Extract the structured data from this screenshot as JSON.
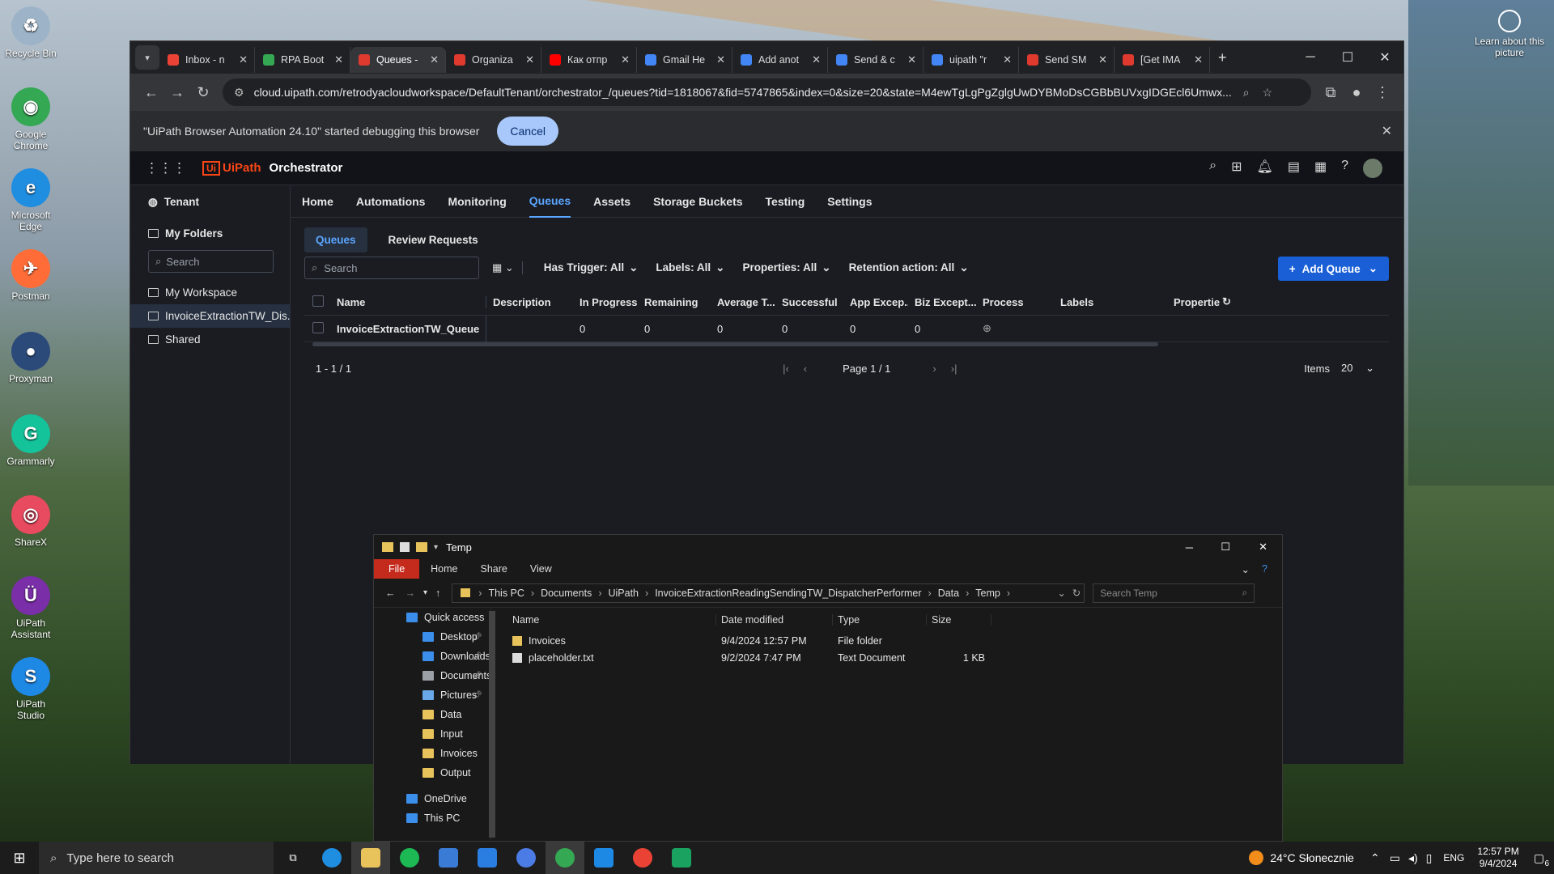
{
  "desktop": {
    "icons": [
      {
        "name": "recycle-bin-icon",
        "label": "Recycle Bin",
        "color": "#9db4c8",
        "glyph": "♻"
      },
      {
        "name": "google-chrome-icon",
        "label": "Google Chrome",
        "color": "#34a853",
        "glyph": "◉"
      },
      {
        "name": "microsoft-edge-icon",
        "label": "Microsoft Edge",
        "color": "#1f8de0",
        "glyph": "e"
      },
      {
        "name": "postman-icon",
        "label": "Postman",
        "color": "#ff6c37",
        "glyph": "✈"
      },
      {
        "name": "proxyman-icon",
        "label": "Proxyman",
        "color": "#2b4a7a",
        "glyph": "●"
      },
      {
        "name": "grammarly-icon",
        "label": "Grammarly",
        "color": "#15c39a",
        "glyph": "G"
      },
      {
        "name": "sharex-icon",
        "label": "ShareX",
        "color": "#e84a5f",
        "glyph": "◎"
      },
      {
        "name": "uipath-assistant-icon",
        "label": "UiPath Assistant",
        "color": "#7a2ea8",
        "glyph": "Ü"
      },
      {
        "name": "uipath-studio-icon",
        "label": "UiPath Studio",
        "color": "#1e88e5",
        "glyph": "S"
      }
    ],
    "learn_about": "Learn about this picture"
  },
  "browser": {
    "tabs": [
      {
        "label": "Inbox - n",
        "color": "#ea4335"
      },
      {
        "label": "RPA Boot",
        "color": "#34a853"
      },
      {
        "label": "Queues -",
        "color": "#e03a2f",
        "active": true
      },
      {
        "label": "Organiza",
        "color": "#e03a2f"
      },
      {
        "label": "Как отпр",
        "color": "#ff0000"
      },
      {
        "label": "Gmail He",
        "color": "#4285f4"
      },
      {
        "label": "Add anot",
        "color": "#4285f4"
      },
      {
        "label": "Send & c",
        "color": "#4285f4"
      },
      {
        "label": "uipath \"r",
        "color": "#4285f4"
      },
      {
        "label": "Send SM",
        "color": "#e03a2f"
      },
      {
        "label": "[Get IMA",
        "color": "#e03a2f"
      }
    ],
    "url": "cloud.uipath.com/retrodyacloudworkspace/DefaultTenant/orchestrator_/queues?tid=1818067&fid=5747865&index=0&size=20&state=M4ewTgLgPgZglgUwDYBMoDsCGBbBUVxgIDGEcl6Umwx...",
    "infobar_text": "\"UiPath Browser Automation 24.10\" started debugging this browser",
    "cancel_label": "Cancel"
  },
  "orchestrator": {
    "brand": "UiPath",
    "product": "Orchestrator",
    "sidebar": {
      "tenant": "Tenant",
      "my_folders": "My Folders",
      "search_placeholder": "Search",
      "items": [
        "My Workspace",
        "InvoiceExtractionTW_Dis...",
        "Shared"
      ]
    },
    "nav": [
      "Home",
      "Automations",
      "Monitoring",
      "Queues",
      "Assets",
      "Storage Buckets",
      "Testing",
      "Settings"
    ],
    "subtabs": [
      "Queues",
      "Review Requests"
    ],
    "search_placeholder": "Search",
    "filters": [
      "Has Trigger: All",
      "Labels: All",
      "Properties: All",
      "Retention action: All"
    ],
    "add_queue": "Add Queue",
    "columns": [
      "Name",
      "Description",
      "In Progress",
      "Remaining",
      "Average T...",
      "Successful",
      "App Excep...",
      "Biz Except...",
      "Process",
      "Labels",
      "Propertie"
    ],
    "rows": [
      {
        "name": "InvoiceExtractionTW_Queue",
        "description": "",
        "in_progress": "0",
        "remaining": "0",
        "average": "0",
        "successful": "0",
        "app_exc": "0",
        "biz_exc": "0"
      }
    ],
    "range": "1 - 1 / 1",
    "page": "Page 1 / 1",
    "items_label": "Items",
    "items_value": "20"
  },
  "explorer": {
    "title": "Temp",
    "ribbon": [
      "File",
      "Home",
      "Share",
      "View"
    ],
    "path": [
      "This PC",
      "Documents",
      "UiPath",
      "InvoiceExtractionReadingSendingTW_DispatcherPerformer",
      "Data",
      "Temp"
    ],
    "search_placeholder": "Search Temp",
    "nav": [
      {
        "label": "Quick access",
        "color": "#3b8eea",
        "pinned": false,
        "indent": 0
      },
      {
        "label": "Desktop",
        "color": "#3b8eea",
        "pinned": true,
        "indent": 1
      },
      {
        "label": "Downloads",
        "color": "#3b8eea",
        "pinned": true,
        "indent": 1
      },
      {
        "label": "Documents",
        "color": "#9aa0a6",
        "pinned": true,
        "indent": 1
      },
      {
        "label": "Pictures",
        "color": "#6aa9e9",
        "pinned": true,
        "indent": 1
      },
      {
        "label": "Data",
        "color": "#e8c25a",
        "pinned": false,
        "indent": 1
      },
      {
        "label": "Input",
        "color": "#e8c25a",
        "pinned": false,
        "indent": 1
      },
      {
        "label": "Invoices",
        "color": "#e8c25a",
        "pinned": false,
        "indent": 1
      },
      {
        "label": "Output",
        "color": "#e8c25a",
        "pinned": false,
        "indent": 1
      },
      {
        "label": "OneDrive",
        "color": "#3b8eea",
        "pinned": false,
        "indent": 0
      },
      {
        "label": "This PC",
        "color": "#3b8eea",
        "pinned": false,
        "indent": 0
      }
    ],
    "columns": [
      "Name",
      "Date modified",
      "Type",
      "Size"
    ],
    "files": [
      {
        "name": "Invoices",
        "date": "9/4/2024 12:57 PM",
        "type": "File folder",
        "size": "",
        "icon_color": "#e8c25a"
      },
      {
        "name": "placeholder.txt",
        "date": "9/2/2024 7:47 PM",
        "type": "Text Document",
        "size": "1 KB",
        "icon_color": "#dcdcdc"
      }
    ]
  },
  "taskbar": {
    "search_placeholder": "Type here to search",
    "weather": "24°C  Słonecznie",
    "lang": "ENG",
    "time": "12:57 PM",
    "date": "9/4/2024",
    "notif_count": "6"
  }
}
